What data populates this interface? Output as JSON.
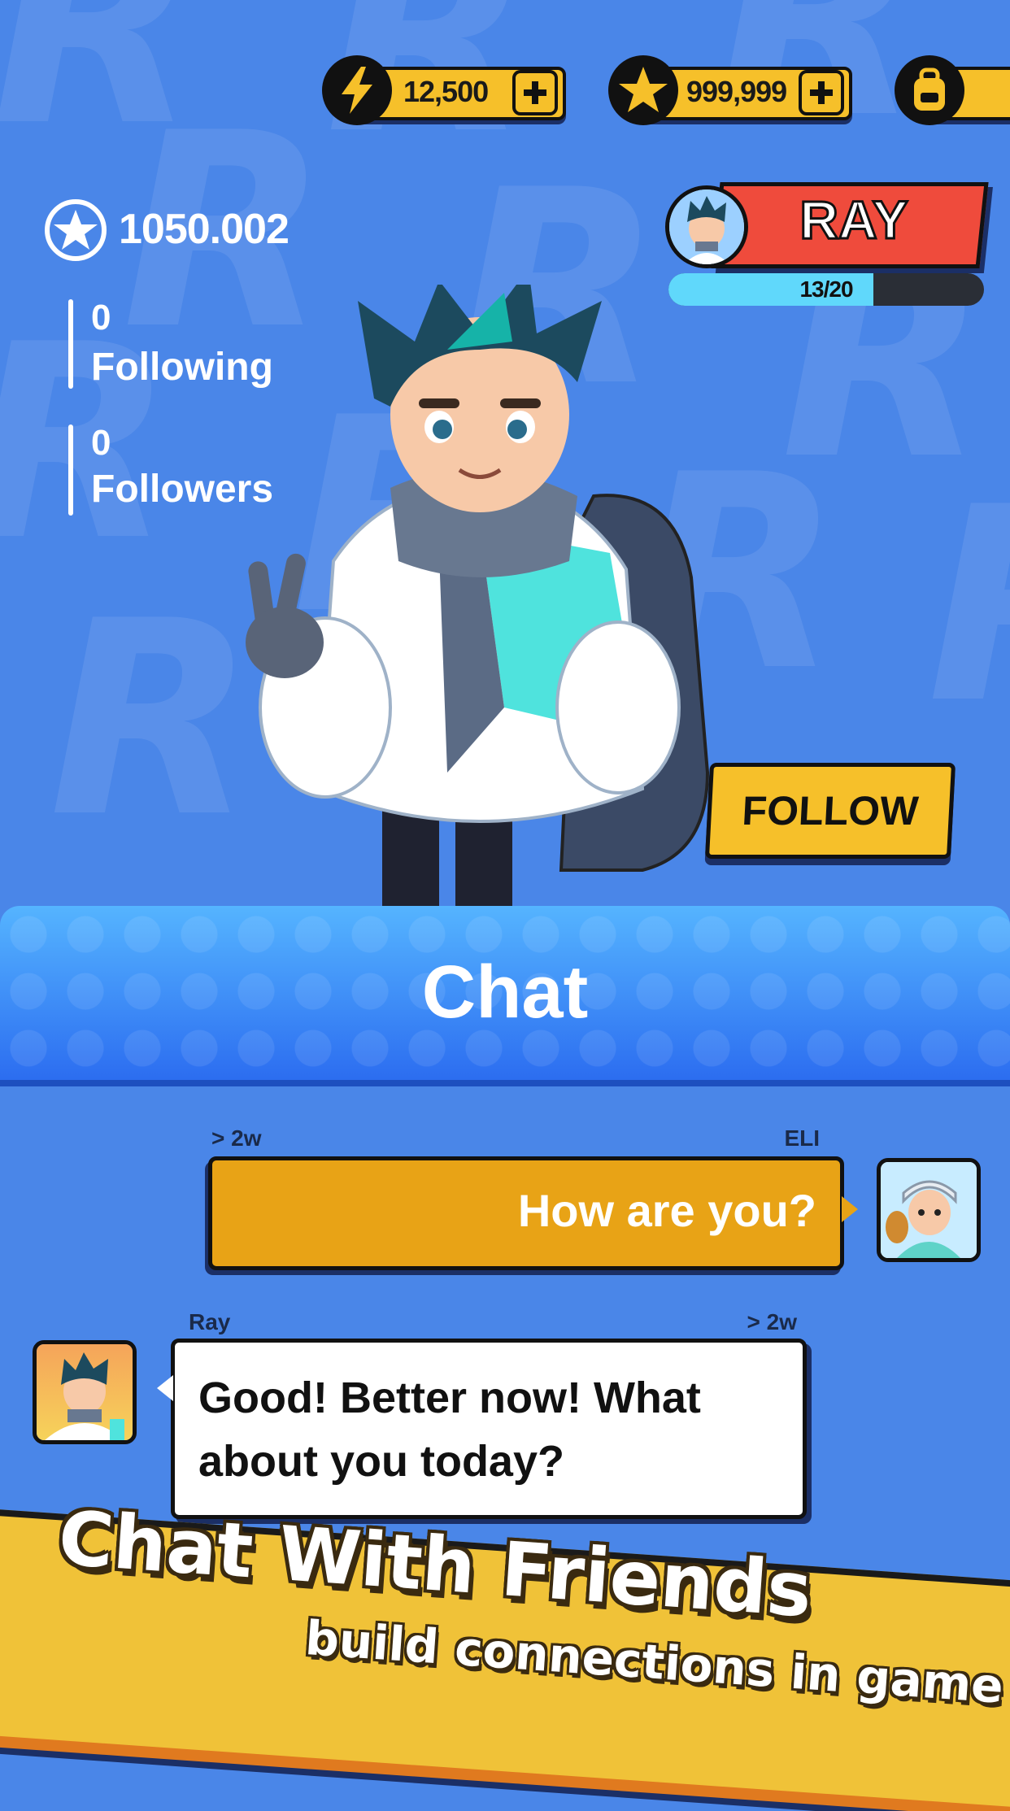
{
  "top_bar": {
    "energy": {
      "icon": "lightning-icon",
      "value": "12,500"
    },
    "stars": {
      "icon": "star-icon",
      "value": "999,999"
    },
    "backpack": {
      "icon": "backpack-icon"
    }
  },
  "profile": {
    "score": "1050.002",
    "score_icon": "star-circle-icon",
    "following_count": "0",
    "following_label": "Following",
    "followers_count": "0",
    "followers_label": "Followers",
    "name": "RAY",
    "level_progress_text": "13/20",
    "level_progress": 0.65,
    "follow_label": "FOLLOW"
  },
  "chat": {
    "title": "Chat",
    "messages": [
      {
        "time": "> 2w",
        "sender": "ELI",
        "text": "How are you?",
        "side": "right"
      },
      {
        "time": "> 2w",
        "sender": "Ray",
        "text": "Good! Better now! What about you today?",
        "side": "left"
      }
    ]
  },
  "banner": {
    "title": "Chat With Friends",
    "subtitle": "build connections in game"
  },
  "colors": {
    "background": "#4a86e8",
    "accent_yellow": "#f6c02a",
    "name_plate_red": "#ef4b3c",
    "xp_cyan": "#60d8fb",
    "bubble_orange": "#e8a316"
  }
}
